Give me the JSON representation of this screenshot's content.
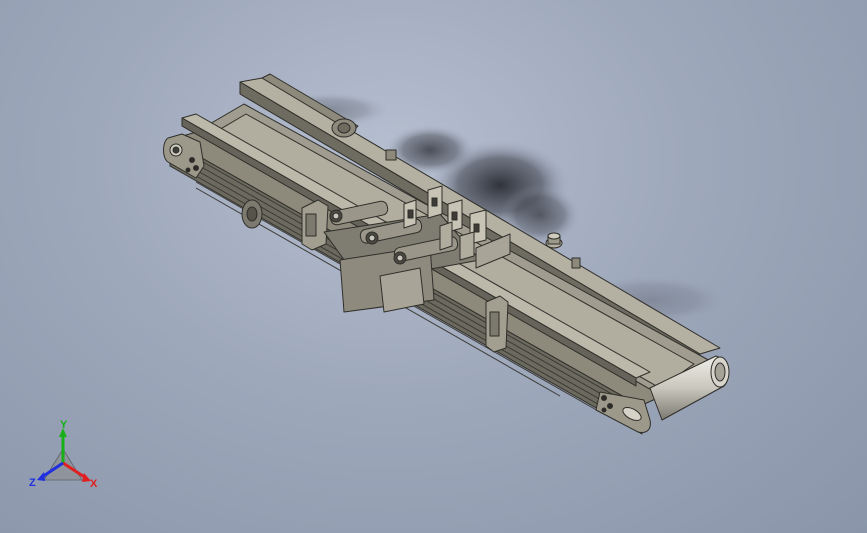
{
  "scene": {
    "background": "#9ea8bb",
    "model": "belt-conveyor",
    "colors": {
      "frame": "#8d8a7c",
      "frame_dark": "#55534a",
      "frame_light": "#b4b1a3",
      "belt": "#a09d90",
      "edge": "#2f2e29"
    }
  },
  "triad": {
    "x_label": "X",
    "y_label": "Y",
    "z_label": "Z",
    "x_color": "#e02020",
    "y_color": "#18b018",
    "z_color": "#2030e0"
  }
}
